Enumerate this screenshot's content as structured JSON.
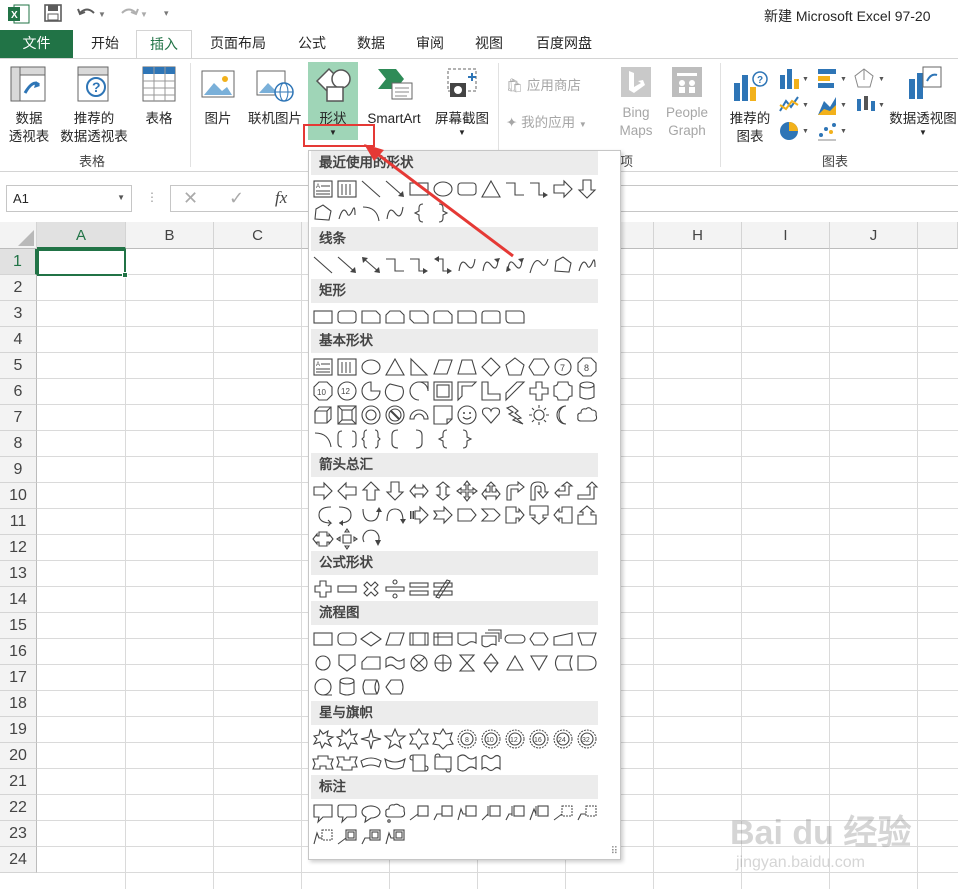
{
  "window": {
    "title": "新建 Microsoft Excel 97-20"
  },
  "tabs": [
    "文件",
    "开始",
    "插入",
    "页面布局",
    "公式",
    "数据",
    "审阅",
    "视图",
    "百度网盘"
  ],
  "ribbon": {
    "tables": {
      "pivot_l1": "数据",
      "pivot_l2": "透视表",
      "rec_pivot_l1": "推荐的",
      "rec_pivot_l2": "数据透视表",
      "table": "表格",
      "group": "表格"
    },
    "illustrations": {
      "picture": "图片",
      "online_picture": "联机图片",
      "shapes": "形状",
      "smartart": "SmartArt",
      "screenshot": "屏幕截图"
    },
    "apps": {
      "store": "应用商店",
      "my_apps": "我的应用",
      "bing_l1": "Bing",
      "bing_l2": "Maps",
      "people_l1": "People",
      "people_l2": "Graph",
      "group_tail": "项"
    },
    "charts": {
      "rec_l1": "推荐的",
      "rec_l2": "图表",
      "pivot_chart": "数据透视图",
      "group": "图表"
    }
  },
  "formula_bar": {
    "name_box": "A1",
    "fx": "fx",
    "cancel": "✕",
    "enter": "✓"
  },
  "grid": {
    "columns": [
      "A",
      "B",
      "C",
      "H",
      "I",
      "J"
    ],
    "rows": [
      "1",
      "2",
      "3",
      "4",
      "5",
      "6",
      "7",
      "8",
      "9",
      "10",
      "11",
      "12",
      "13",
      "14",
      "15",
      "16",
      "17",
      "18",
      "19",
      "20",
      "21",
      "22",
      "23",
      "24"
    ]
  },
  "shapes_menu": {
    "sections": [
      "最近使用的形状",
      "线条",
      "矩形",
      "基本形状",
      "箭头总汇",
      "公式形状",
      "流程图",
      "星与旗帜",
      "标注"
    ]
  },
  "watermark": {
    "brand": "Bai du 经验",
    "url": "jingyan.baidu.com"
  },
  "colors": {
    "accent": "#217346",
    "highlight": "#e53935"
  }
}
